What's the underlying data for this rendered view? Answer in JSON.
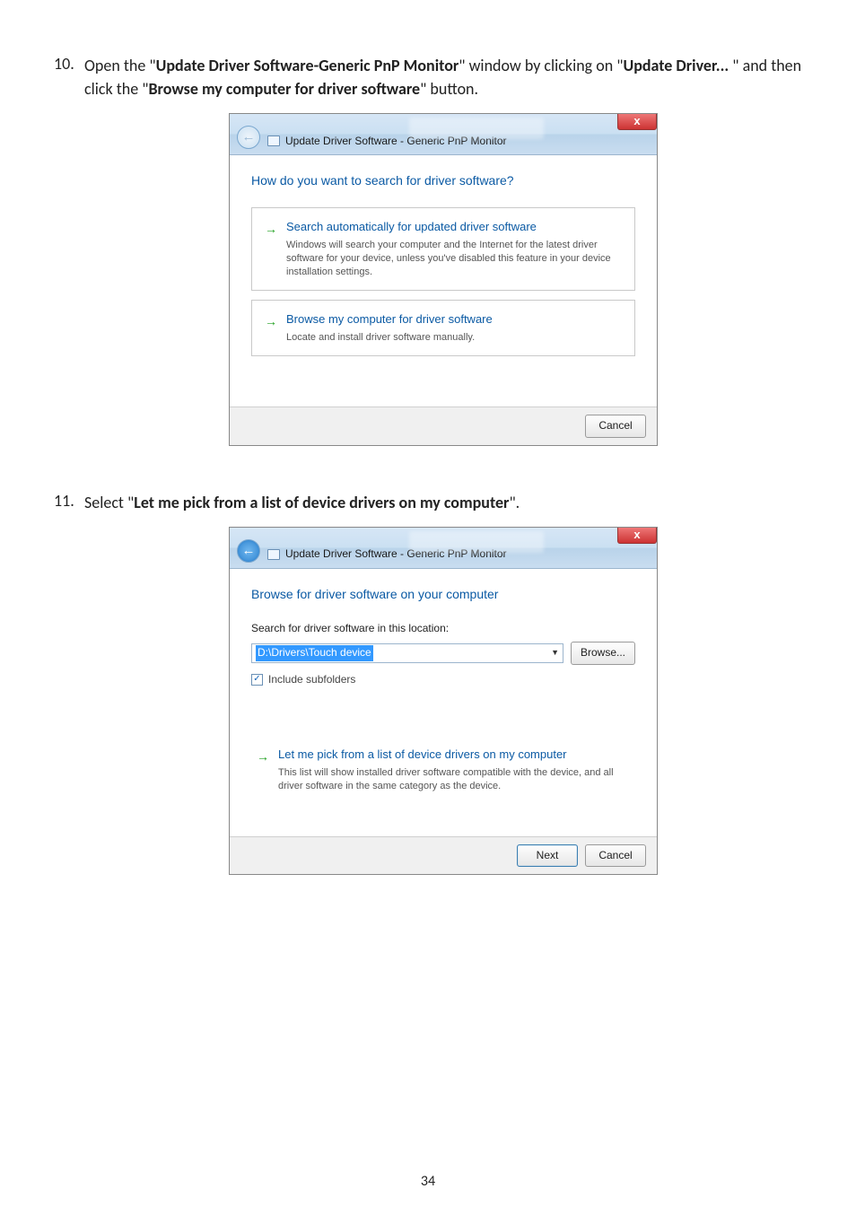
{
  "page_number": "34",
  "steps": [
    {
      "number": "10.",
      "segments": [
        {
          "text": "Open the \"",
          "bold": false
        },
        {
          "text": "Update Driver Software-Generic PnP Monitor",
          "bold": true
        },
        {
          "text": "\" window by clicking on \"",
          "bold": false
        },
        {
          "text": "Update Driver...",
          "bold": true
        },
        {
          "text": " \" and then click the \"",
          "bold": false
        },
        {
          "text": "Browse my computer for driver software",
          "bold": true
        },
        {
          "text": "\" button.",
          "bold": false
        }
      ]
    },
    {
      "number": "11.",
      "segments": [
        {
          "text": "Select \"",
          "bold": false
        },
        {
          "text": "Let me pick from a list of device drivers on my computer",
          "bold": true
        },
        {
          "text": "\".",
          "bold": false
        }
      ]
    }
  ],
  "win1": {
    "breadcrumb": "Update Driver Software - Generic PnP Monitor",
    "close_glyph": "x",
    "heading": "How do you want to search for driver software?",
    "opt1": {
      "title": "Search automatically for updated driver software",
      "desc": "Windows will search your computer and the Internet for the latest driver software for your device, unless you've disabled this feature in your device installation settings."
    },
    "opt2": {
      "title": "Browse my computer for driver software",
      "desc": "Locate and install driver software manually."
    },
    "cancel": "Cancel"
  },
  "win2": {
    "breadcrumb": "Update Driver Software - Generic PnP Monitor",
    "close_glyph": "x",
    "back_glyph": "←",
    "heading": "Browse for driver software on your computer",
    "search_label": "Search for driver software in this location:",
    "path_value": "D:\\Drivers\\Touch device",
    "browse_btn": "Browse...",
    "include_subfolders": "Include subfolders",
    "opt": {
      "title": "Let me pick from a list of device drivers on my computer",
      "desc": "This list will show installed driver software compatible with the device, and all driver software in the same category as the device."
    },
    "next": "Next",
    "cancel": "Cancel"
  }
}
